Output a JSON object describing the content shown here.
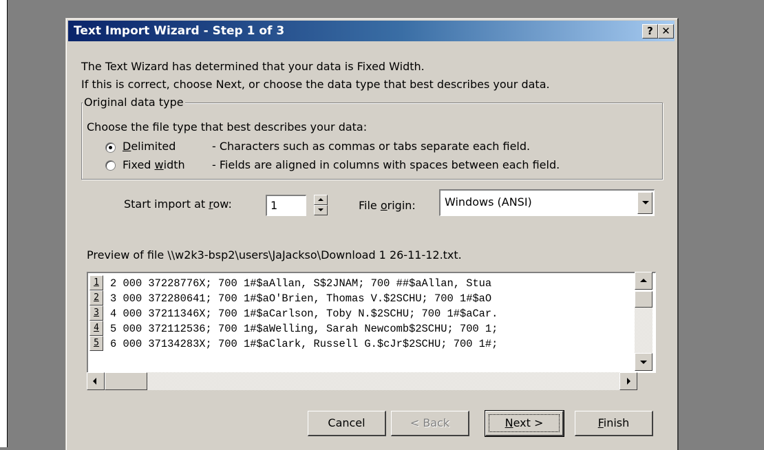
{
  "window": {
    "title": "Text Import Wizard - Step 1 of 3",
    "help_label": "?",
    "close_label": "✕"
  },
  "intro": {
    "line1": "The Text Wizard has determined that your data is Fixed Width.",
    "line2": "If this is correct, choose Next, or choose the data type that best describes your data."
  },
  "original_data_type": {
    "legend": "Original data type",
    "prompt": "Choose the file type that best describes your data:",
    "options": [
      {
        "label_prefix": "",
        "label_key": "D",
        "label_rest": "elimited",
        "description": "- Characters such as commas or tabs separate each field.",
        "checked": true
      },
      {
        "label_prefix": "Fixed ",
        "label_key": "w",
        "label_rest": "idth",
        "description": "- Fields are aligned in columns with spaces between each field.",
        "checked": false
      }
    ]
  },
  "start_row": {
    "label_prefix": "Start import at ",
    "label_key": "r",
    "label_rest": "ow:",
    "value": "1"
  },
  "file_origin": {
    "label_prefix": "File ",
    "label_key": "o",
    "label_rest": "rigin:",
    "value": "Windows (ANSI)"
  },
  "preview": {
    "label": "Preview of file \\\\w2k3-bsp2\\users\\JaJackso\\Download 1 26-11-12.txt.",
    "rows": [
      {
        "num": "1",
        "text": "2 000 37228776X; 700 1#$aAllan, S$2JNAM; 700 ##$aAllan, Stua"
      },
      {
        "num": "2",
        "text": "3 000 372280641; 700 1#$aO'Brien, Thomas V.$2SCHU; 700 1#$aO"
      },
      {
        "num": "3",
        "text": "4 000 37211346X; 700 1#$aCarlson, Toby N.$2SCHU; 700 1#$aCar."
      },
      {
        "num": "4",
        "text": "5 000 372112536; 700 1#$aWelling, Sarah Newcomb$2SCHU; 700 1;"
      },
      {
        "num": "5",
        "text": "6 000 37134283X; 700 1#$aClark, Russell G.$cJr$2SCHU; 700 1#;"
      }
    ]
  },
  "buttons": {
    "cancel": "Cancel",
    "back": "< Back",
    "next_key": "N",
    "next_rest": "ext >",
    "finish_key": "F",
    "finish_rest": "inish"
  },
  "colors": {
    "titlebar_start": "#0a246a",
    "titlebar_end": "#a6caf0",
    "dialog_face": "#d4d0c8"
  }
}
